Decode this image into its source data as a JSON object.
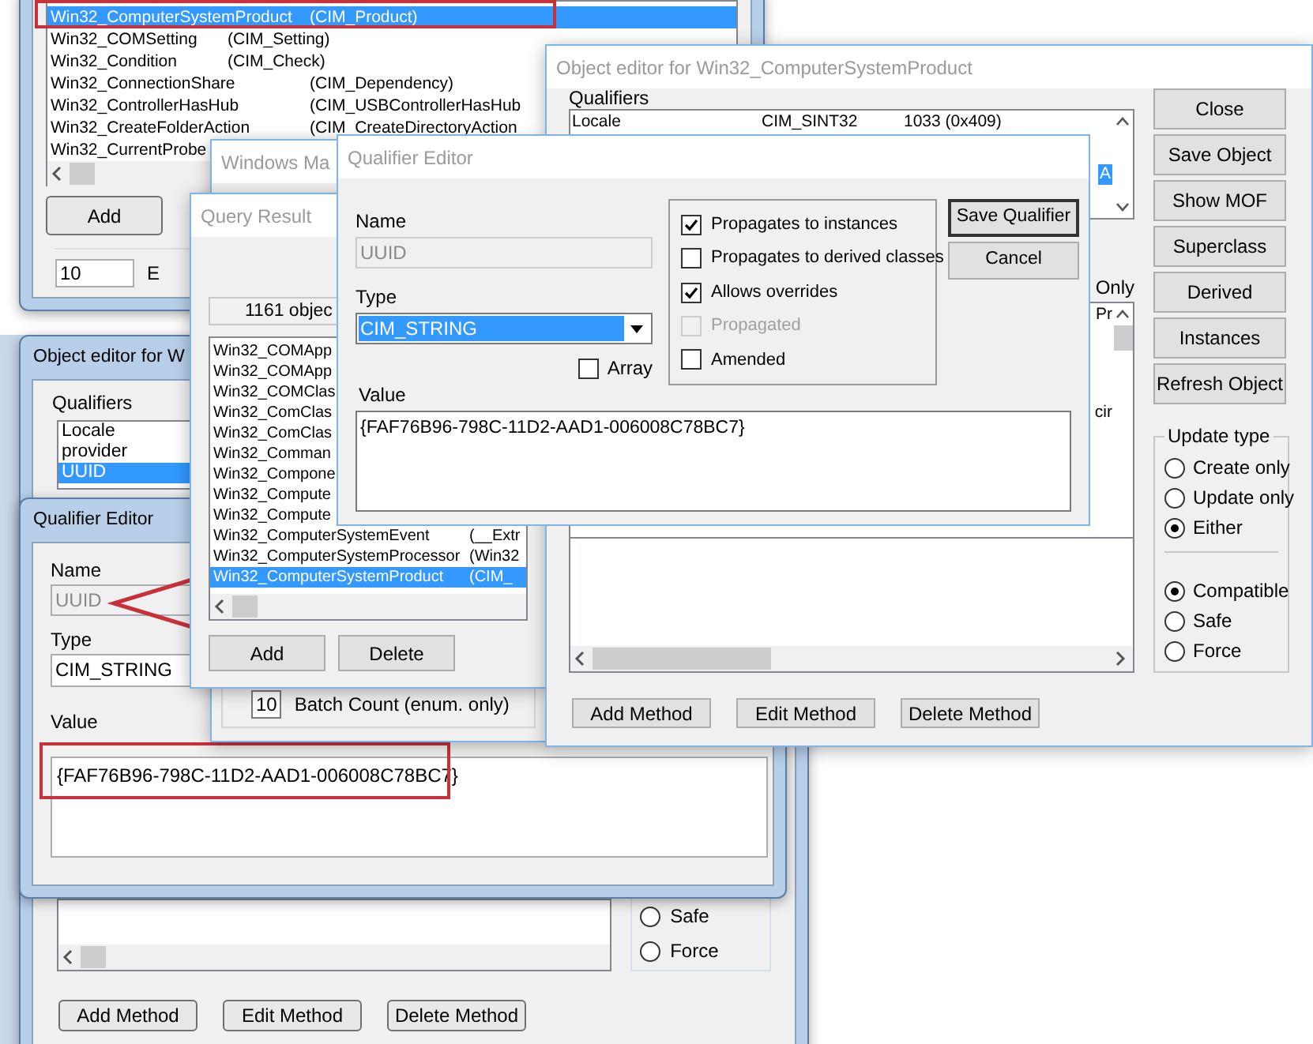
{
  "class_browser": {
    "rows": [
      {
        "name": "Win32_ComputerSystemProduct",
        "parent": "(CIM_Product)",
        "selected": true
      },
      {
        "name": "Win32_COMSetting",
        "parent": "(CIM_Setting)",
        "selected": false
      },
      {
        "name": "Win32_Condition",
        "parent": "(CIM_Check)",
        "selected": false
      },
      {
        "name": "Win32_ConnectionShare",
        "parent": "(CIM_Dependency)",
        "selected": false
      },
      {
        "name": "Win32_ControllerHasHub",
        "parent": "(CIM_USBControllerHasHub",
        "selected": false
      },
      {
        "name": "Win32_CreateFolderAction",
        "parent": "(CIM_CreateDirectoryAction",
        "selected": false
      },
      {
        "name": "Win32_CurrentProbe",
        "selected": false
      }
    ],
    "add_button": "Add",
    "batch_count": "10",
    "batch_label": "E"
  },
  "object_editor_back": {
    "title": "Object editor for W",
    "qualifiers_label": "Qualifiers",
    "qualifiers": [
      {
        "name": "Locale",
        "selected": false
      },
      {
        "name": "provider",
        "selected": false
      },
      {
        "name": "UUID",
        "selected": true
      }
    ],
    "radios": [
      {
        "label": "Safe",
        "selected": false
      },
      {
        "label": "Force",
        "selected": false
      }
    ],
    "buttons": [
      "Add Method",
      "Edit Method",
      "Delete Method"
    ]
  },
  "qualifier_editor_back": {
    "title": "Qualifier Editor",
    "name_label": "Name",
    "name": "UUID",
    "type_label": "Type",
    "type": "CIM_STRING",
    "value_label": "Value",
    "value": "{FAF76B96-798C-11D2-AAD1-006008C78BC7}"
  },
  "wmi_window": {
    "title": "Windows Ma",
    "batch_count": "10",
    "batch_label": "Batch Count (enum. only)"
  },
  "query_result": {
    "title": "Query Result",
    "count": "1161 objec",
    "rows": [
      {
        "name": "Win32_COMApp",
        "selected": false
      },
      {
        "name": "Win32_COMApp",
        "selected": false
      },
      {
        "name": "Win32_COMClas",
        "selected": false
      },
      {
        "name": "Win32_ComClas",
        "selected": false
      },
      {
        "name": "Win32_ComClas",
        "selected": false
      },
      {
        "name": "Win32_Comman",
        "selected": false
      },
      {
        "name": "Win32_Compone",
        "selected": false
      },
      {
        "name": "Win32_Compute",
        "selected": false
      },
      {
        "name": "Win32_Compute",
        "selected": false
      },
      {
        "name": "Win32_ComputerSystemEvent",
        "parent": "(__Extr",
        "selected": false
      },
      {
        "name": "Win32_ComputerSystemProcessor",
        "parent": "(Win32",
        "selected": false
      },
      {
        "name": "Win32_ComputerSystemProduct",
        "parent": "(CIM_",
        "selected": true
      }
    ],
    "buttons": [
      "Add",
      "Delete"
    ]
  },
  "object_editor": {
    "title": "Object editor for Win32_ComputerSystemProduct",
    "qualifiers_label": "Qualifiers",
    "qualifier_rows": [
      {
        "name": "Locale",
        "type": "CIM_SINT32",
        "value": "1033 (0x409)",
        "selected": false
      },
      {
        "value": "A",
        "selected": true
      }
    ],
    "properties_header": "Only",
    "property_fragments": [
      "Pr",
      "cir"
    ],
    "buttons": [
      "Close",
      "Save Object",
      "Show MOF",
      "Superclass",
      "Derived",
      "Instances",
      "Refresh Object"
    ],
    "update_type": {
      "label": "Update type",
      "groups": [
        [
          {
            "label": "Create only",
            "selected": false
          },
          {
            "label": "Update only",
            "selected": false
          },
          {
            "label": "Either",
            "selected": true
          }
        ],
        [
          {
            "label": "Compatible",
            "selected": true
          },
          {
            "label": "Safe",
            "selected": false
          },
          {
            "label": "Force",
            "selected": false
          }
        ]
      ]
    },
    "method_buttons": [
      "Add Method",
      "Edit Method",
      "Delete Method"
    ]
  },
  "qualifier_editor": {
    "title": "Qualifier Editor",
    "name_label": "Name",
    "name": "UUID",
    "type_label": "Type",
    "type": "CIM_STRING",
    "array": {
      "label": "Array",
      "checked": false
    },
    "value_label": "Value",
    "value": "{FAF76B96-798C-11D2-AAD1-006008C78BC7}",
    "flags": [
      {
        "label": "Propagates to instances",
        "checked": true,
        "disabled": false
      },
      {
        "label": "Propagates to derived classes",
        "checked": false,
        "disabled": false
      },
      {
        "label": "Allows overrides",
        "checked": true,
        "disabled": false
      },
      {
        "label": "Propagated",
        "checked": false,
        "disabled": true
      },
      {
        "label": "Amended",
        "checked": false,
        "disabled": false
      }
    ],
    "buttons": [
      "Save Qualifier",
      "Cancel"
    ]
  }
}
